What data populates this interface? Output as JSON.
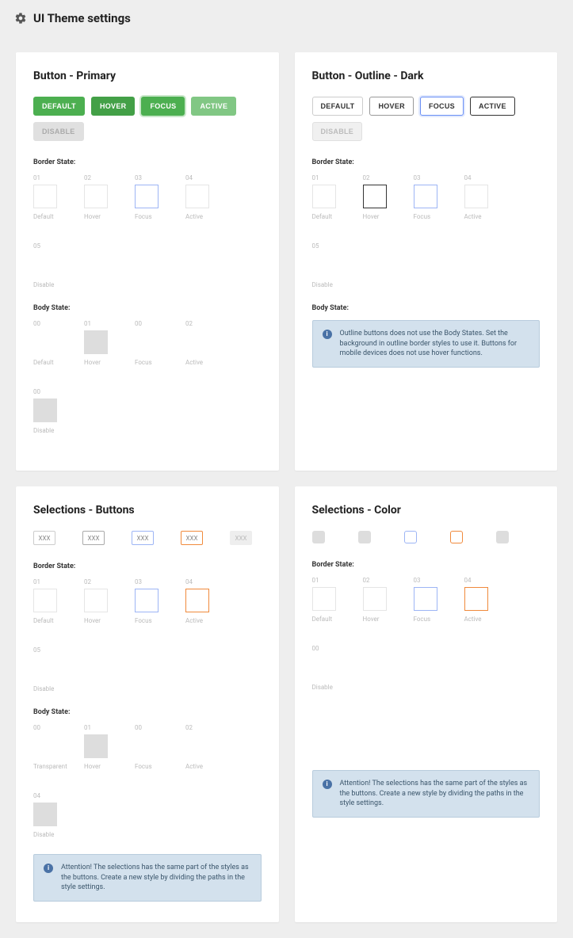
{
  "header": {
    "title": "UI Theme settings"
  },
  "cards": {
    "primary": {
      "title": "Button - Primary",
      "buttons": [
        "DEFAULT",
        "HOVER",
        "FOCUS",
        "ACTIVE",
        "DISABLE"
      ],
      "border_section_label": "Border State:",
      "border_states": [
        {
          "num": "01",
          "label": "Default"
        },
        {
          "num": "02",
          "label": "Hover"
        },
        {
          "num": "03",
          "label": "Focus"
        },
        {
          "num": "04",
          "label": "Active"
        },
        {
          "num": "05",
          "label": "Disable"
        }
      ],
      "body_section_label": "Body State:",
      "body_states": [
        {
          "num": "00",
          "label": "Default"
        },
        {
          "num": "01",
          "label": "Hover"
        },
        {
          "num": "00",
          "label": "Focus"
        },
        {
          "num": "02",
          "label": "Active"
        },
        {
          "num": "00",
          "label": "Disable"
        }
      ]
    },
    "outline": {
      "title": "Button - Outline - Dark",
      "buttons": [
        "DEFAULT",
        "HOVER",
        "FOCUS",
        "ACTIVE",
        "DISABLE"
      ],
      "border_section_label": "Border State:",
      "border_states": [
        {
          "num": "01",
          "label": "Default"
        },
        {
          "num": "02",
          "label": "Hover"
        },
        {
          "num": "03",
          "label": "Focus"
        },
        {
          "num": "04",
          "label": "Active"
        },
        {
          "num": "05",
          "label": "Disable"
        }
      ],
      "body_section_label": "Body State:",
      "info": "Outline buttons does not use the Body States. Set the background in outline border styles to use it. Buttons for mobile devices does not use hover functions."
    },
    "selections_buttons": {
      "title": "Selections - Buttons",
      "sel_labels": [
        "XXX",
        "XXX",
        "XXX",
        "XXX",
        "XXX"
      ],
      "border_section_label": "Border State:",
      "border_states": [
        {
          "num": "01",
          "label": "Default"
        },
        {
          "num": "02",
          "label": "Hover"
        },
        {
          "num": "03",
          "label": "Focus"
        },
        {
          "num": "04",
          "label": "Active"
        },
        {
          "num": "05",
          "label": "Disable"
        }
      ],
      "body_section_label": "Body State:",
      "body_states": [
        {
          "num": "00",
          "label": "Transparent"
        },
        {
          "num": "01",
          "label": "Hover"
        },
        {
          "num": "00",
          "label": "Focus"
        },
        {
          "num": "02",
          "label": "Active"
        },
        {
          "num": "04",
          "label": "Disable"
        }
      ],
      "info": "Attention! The selections has the same part of the styles as the buttons. Create a new style by dividing the paths in the style settings."
    },
    "selections_color": {
      "title": "Selections - Color",
      "border_section_label": "Border State:",
      "border_states": [
        {
          "num": "01",
          "label": "Default"
        },
        {
          "num": "02",
          "label": "Hover"
        },
        {
          "num": "03",
          "label": "Focus"
        },
        {
          "num": "04",
          "label": "Active"
        },
        {
          "num": "00",
          "label": "Disable"
        }
      ],
      "info": "Attention! The selections has the same part of the styles as the buttons. Create a new style by dividing the paths in the style settings."
    }
  }
}
